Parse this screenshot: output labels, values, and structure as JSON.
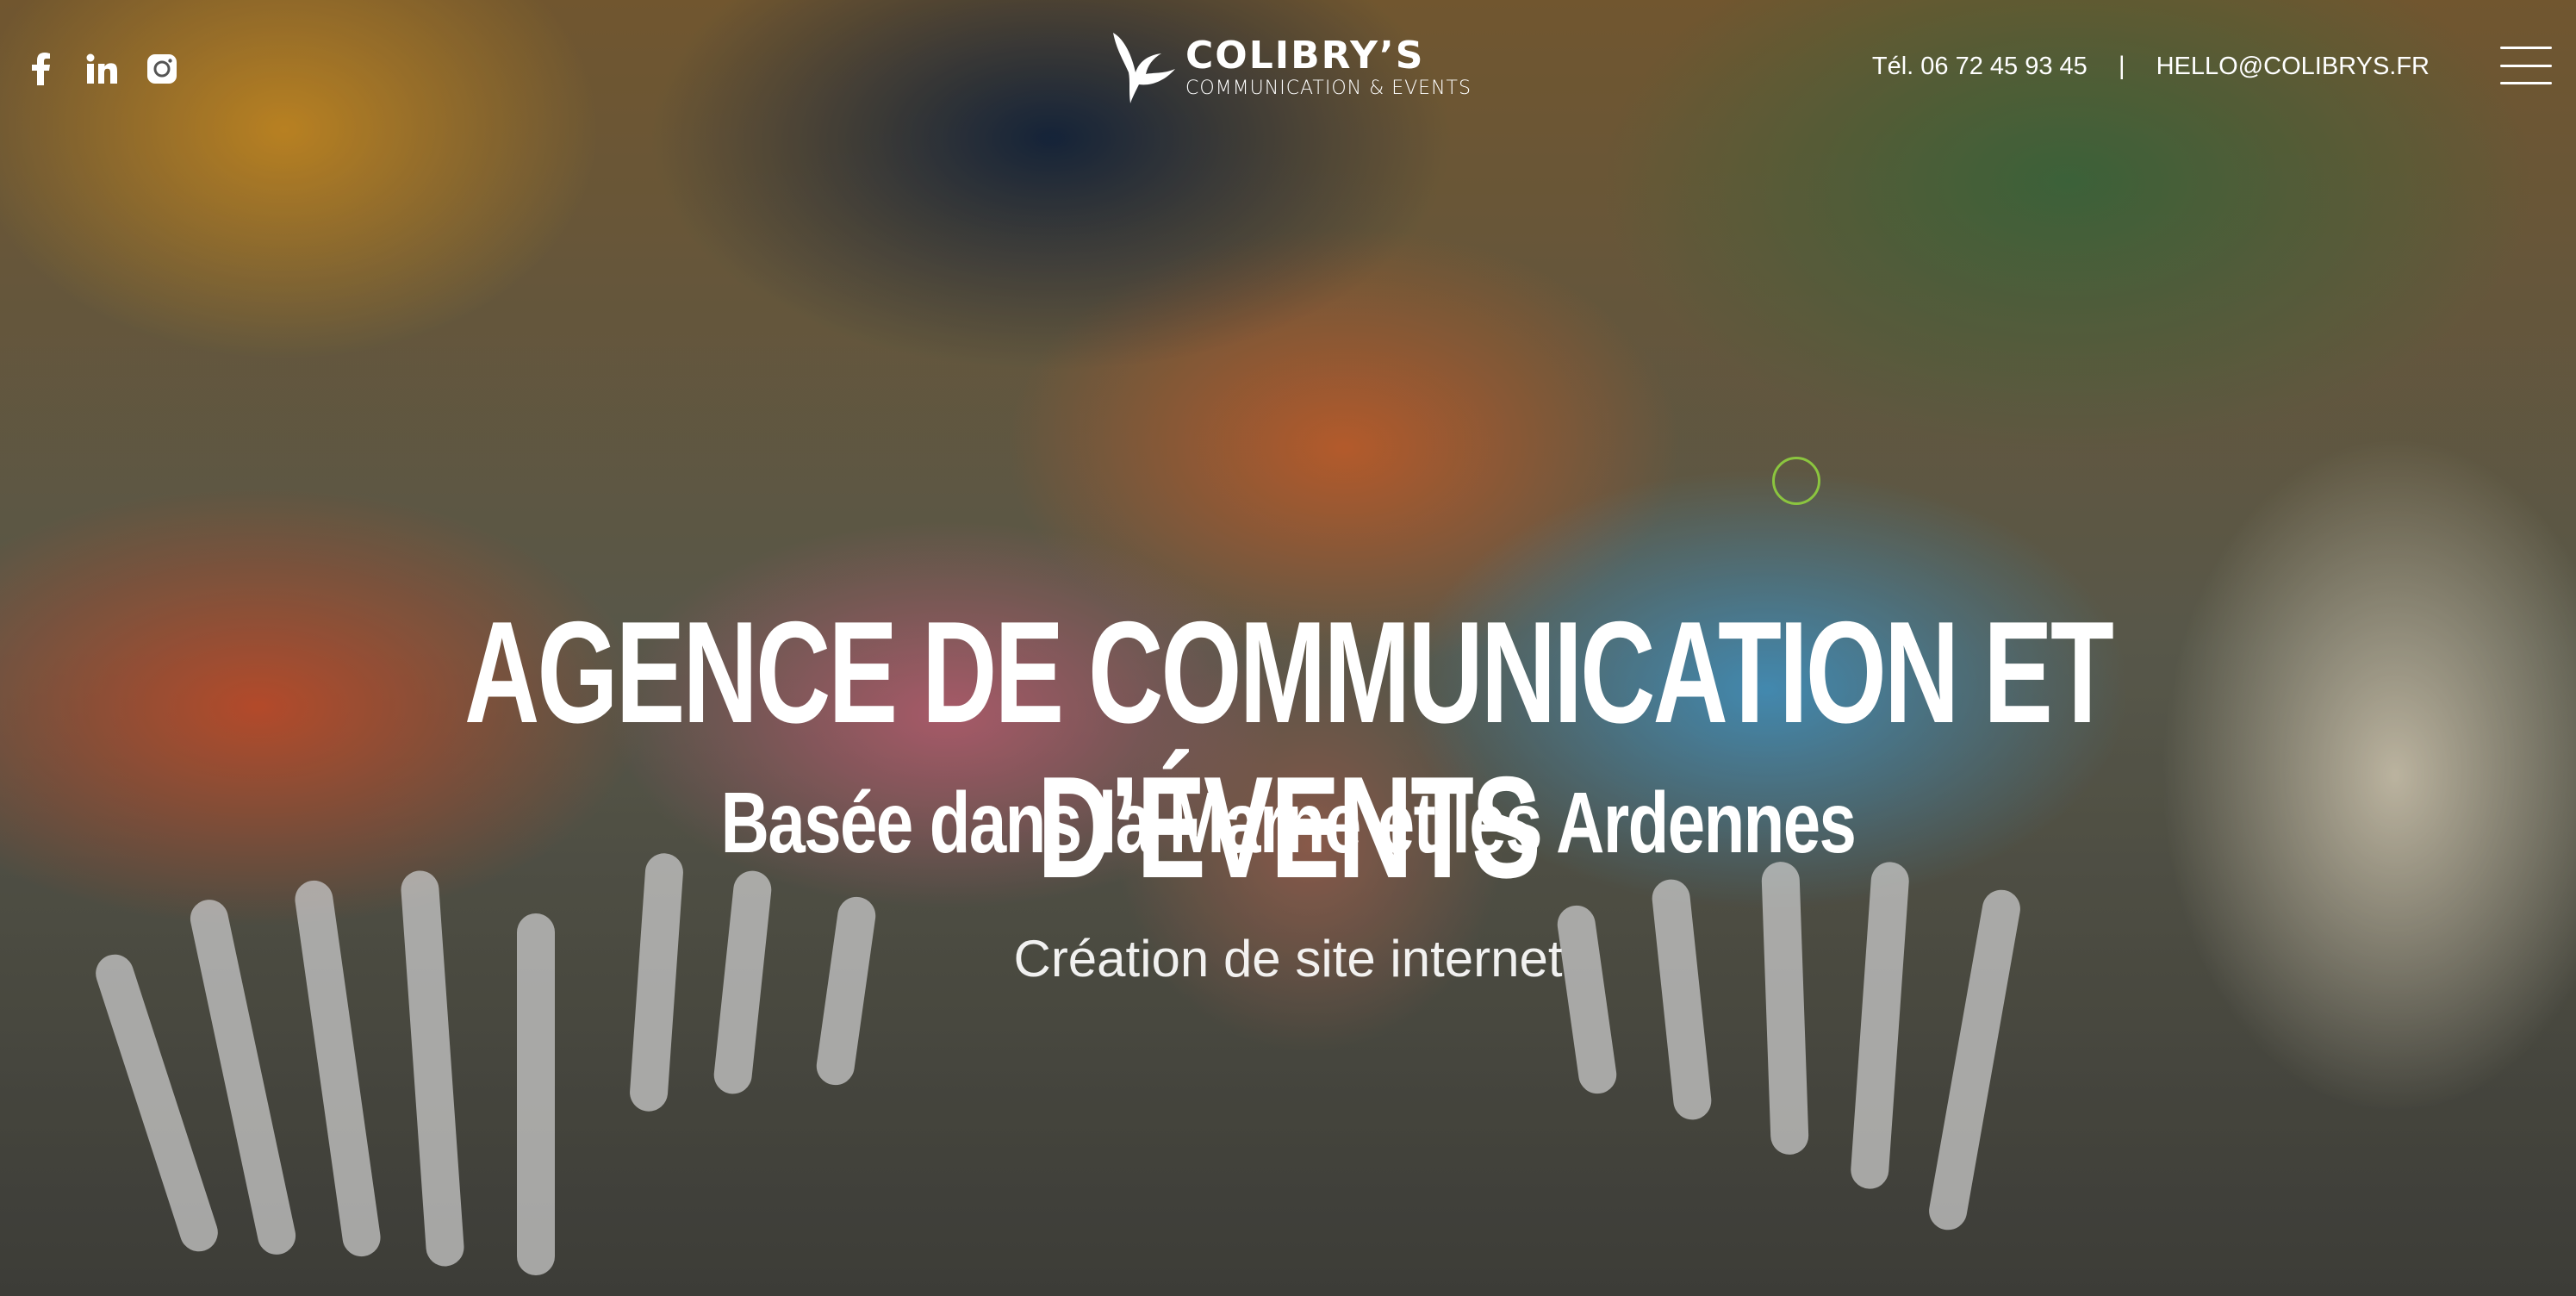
{
  "header": {
    "social": [
      {
        "icon": "facebook-icon",
        "label": "f"
      },
      {
        "icon": "linkedin-icon",
        "label": "in"
      },
      {
        "icon": "instagram-icon",
        "label": ""
      }
    ],
    "logo": {
      "name": "COLIBRY’S",
      "subtitle": "COMMUNICATION & EVENTS",
      "icon": "hummingbird-icon"
    },
    "phone": "Tél. 06 72 45 93 45",
    "separator": "|",
    "email": "HELLO@COLIBRYS.FR",
    "menu_icon": "hamburger-menu-icon"
  },
  "hero": {
    "title": "AGENCE DE COMMUNICATION ET D’ÉVENTS",
    "subtitle": "Basée dans la Marne et les Ardennes",
    "tagline": "Création de site internet"
  },
  "colors": {
    "text": "#ffffff",
    "cursor_ring": "#8bc53f"
  }
}
